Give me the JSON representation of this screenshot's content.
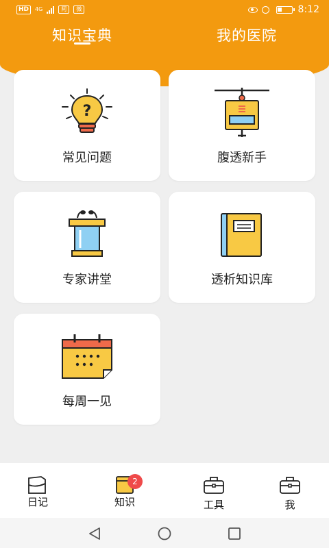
{
  "status_bar": {
    "left_badges": [
      "HD",
      "4G"
    ],
    "app_icons": [
      "阿",
      "微"
    ],
    "time": "8:12",
    "icons": [
      "eye-icon",
      "alarm-icon",
      "battery-icon"
    ]
  },
  "header": {
    "tabs": [
      {
        "label": "知识宝典",
        "active": true
      },
      {
        "label": "我的医院",
        "active": false
      }
    ]
  },
  "cards": [
    {
      "label": "常见问题",
      "icon": "lightbulb-question-icon"
    },
    {
      "label": "腹透新手",
      "icon": "dialysis-bag-icon"
    },
    {
      "label": "专家讲堂",
      "icon": "podium-icon"
    },
    {
      "label": "透析知识库",
      "icon": "book-icon"
    },
    {
      "label": "每周一见",
      "icon": "calendar-icon"
    }
  ],
  "bottom_nav": {
    "items": [
      {
        "label": "日记",
        "icon": "diary-icon"
      },
      {
        "label": "知识",
        "icon": "knowledge-icon",
        "badge": "2",
        "active": true
      },
      {
        "label": "工具",
        "icon": "toolbox-icon"
      },
      {
        "label": "我",
        "icon": "profile-icon"
      }
    ]
  },
  "colors": {
    "brand_orange": "#f39a0f",
    "icon_yellow": "#f8c944",
    "icon_blue": "#8fd0f3",
    "icon_red": "#ef6a4a",
    "badge_red": "#ef4a4a",
    "background": "#efefef"
  }
}
